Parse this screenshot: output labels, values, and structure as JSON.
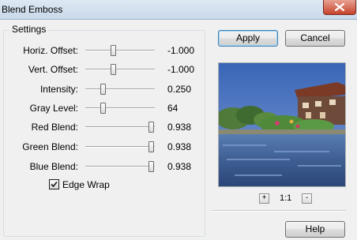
{
  "window": {
    "title": "Blend Emboss"
  },
  "group": {
    "title": "Settings"
  },
  "settings": [
    {
      "label": "Horiz. Offset:",
      "value": "-1.000",
      "level": 0.4
    },
    {
      "label": "Vert. Offset:",
      "value": "-1.000",
      "level": 0.4
    },
    {
      "label": "Intensity:",
      "value": "0.250",
      "level": 0.25
    },
    {
      "label": "Gray Level:",
      "value": "64",
      "level": 0.25
    },
    {
      "label": "Red Blend:",
      "value": "0.938",
      "level": 0.938
    },
    {
      "label": "Green Blend:",
      "value": "0.938",
      "level": 0.938
    },
    {
      "label": "Blue Blend:",
      "value": "0.938",
      "level": 0.938
    }
  ],
  "edge_wrap": {
    "label": "Edge Wrap",
    "checked": true
  },
  "buttons": {
    "apply": "Apply",
    "cancel": "Cancel",
    "help": "Help"
  },
  "zoom": {
    "in": "+",
    "out": "-",
    "level": "1:1"
  }
}
